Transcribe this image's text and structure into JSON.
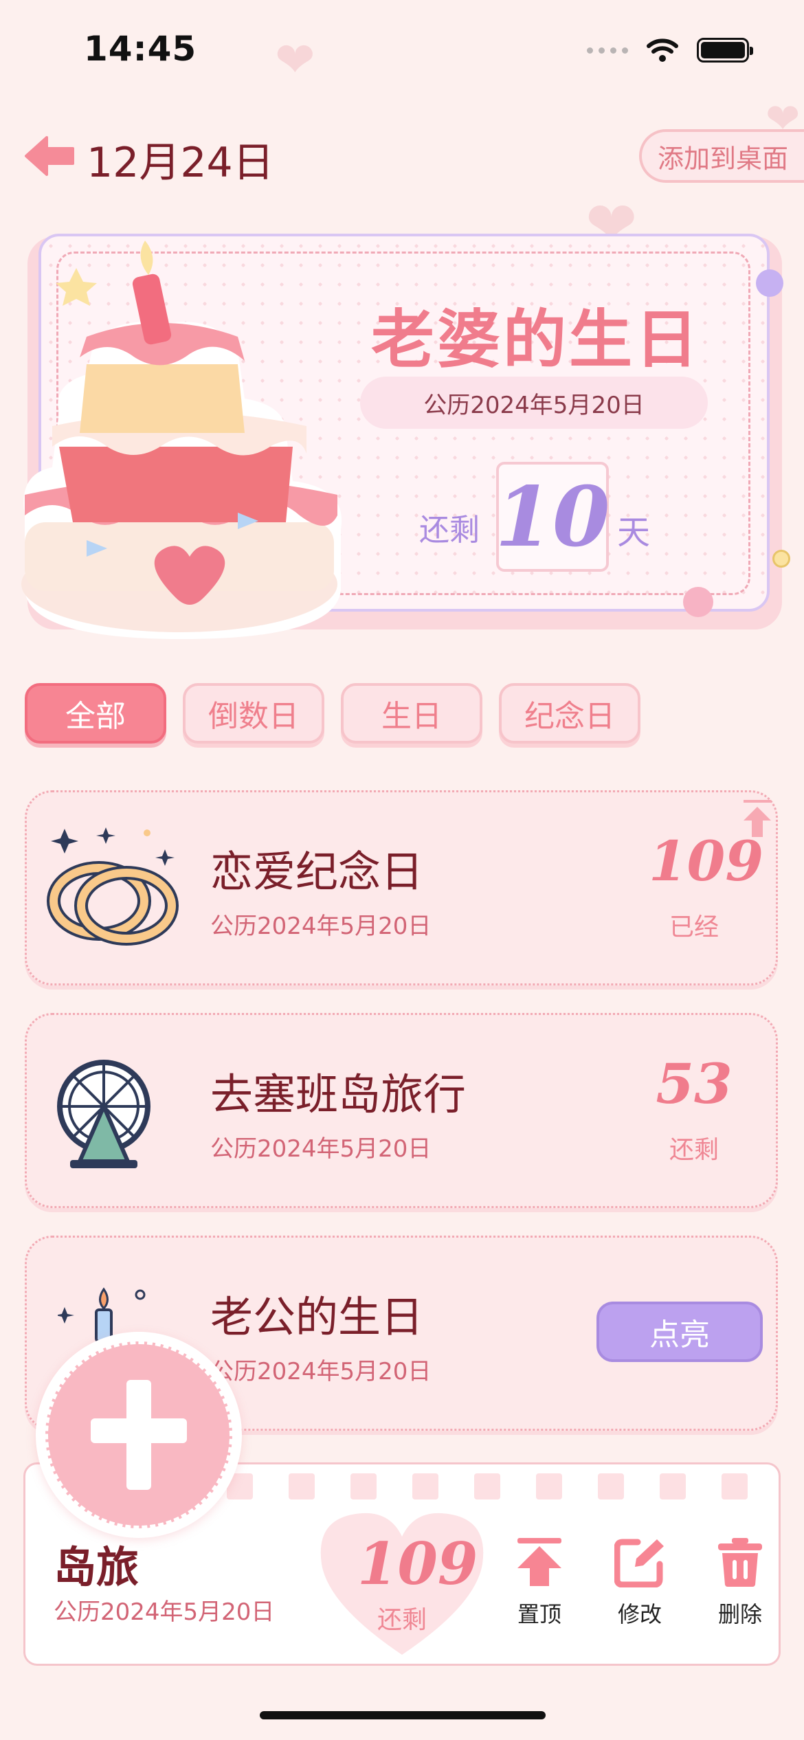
{
  "status_bar": {
    "time": "14:45"
  },
  "header": {
    "date_title": "12月24日",
    "add_to_desktop_label": "添加到桌面"
  },
  "hero": {
    "title": "老婆的生日",
    "date": "公历2024年5月20日",
    "remaining_label": "还剩",
    "days": "10",
    "day_unit": "天"
  },
  "filters": {
    "tabs": [
      {
        "label": "全部",
        "active": true
      },
      {
        "label": "倒数日",
        "active": false
      },
      {
        "label": "生日",
        "active": false
      },
      {
        "label": "纪念日",
        "active": false
      }
    ]
  },
  "events": [
    {
      "title": "恋爱纪念日",
      "date": "公历2024年5月20日",
      "count": "109",
      "status": "已经",
      "icon": "rings-icon"
    },
    {
      "title": "去塞班岛旅行",
      "date": "公历2024年5月20日",
      "count": "53",
      "status": "还剩",
      "icon": "ferris-wheel-icon"
    },
    {
      "title": "老公的生日",
      "date": "公历2024年5月20日",
      "button": "点亮",
      "icon": "birthday-cake-icon"
    }
  ],
  "detail_panel": {
    "title": "岛旅",
    "date": "公历2024年5月20日",
    "count": "109",
    "status": "还剩",
    "actions": {
      "pin": "置顶",
      "edit": "修改",
      "delete": "删除"
    }
  },
  "colors": {
    "accent_pink": "#f78593",
    "lavender": "#bca1ef",
    "dark_red": "#7a1f2a",
    "background": "#fdf0ee"
  }
}
